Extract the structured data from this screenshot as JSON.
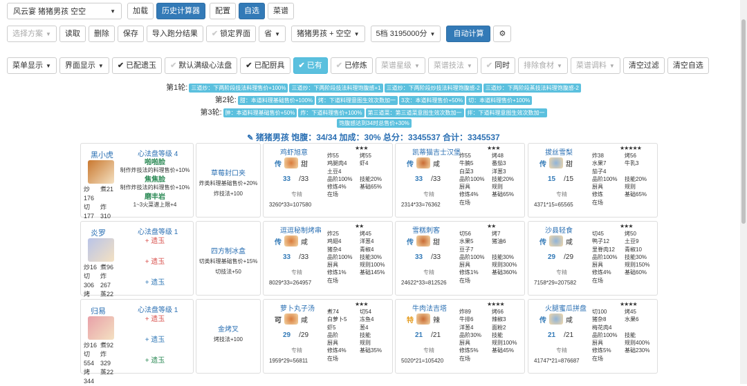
{
  "toolbar1": {
    "rule_select": "风云宴 猪猪男孩 空空",
    "load": "加载",
    "history_calc": "历史计算器",
    "config": "配置",
    "custom": "自选",
    "recipes": "菜谱"
  },
  "toolbar2": {
    "scheme_placeholder": "选择方案",
    "read": "读取",
    "delete": "删除",
    "save": "保存",
    "import": "导入跑分结果",
    "lock": "锁定界面",
    "province": "省",
    "guests": "猪猪男孩 + 空空",
    "grade": "5档 3195000分",
    "auto_calc": "自动计算"
  },
  "toolbar3": {
    "menu_display": "菜单显示",
    "ui_display": "界面显示",
    "with_jade": "已配遗玉",
    "default_full": "默认满级心法盘",
    "with_tools": "已配厨具",
    "owned": "已有",
    "cultivated": "已修炼",
    "recipe_star": "菜谱星级",
    "recipe_skill": "菜谱技法",
    "same_time": "同时",
    "exclude_ing": "排除食材",
    "recipe_season": "菜谱调料",
    "clear_filter": "清空过滤",
    "clear_custom": "清空自选"
  },
  "rounds": [
    {
      "label": "第1轮:",
      "badges": [
        "三道炒：下两阶段技法料理售价+100%",
        "三道炒：下两阶段技法料理饱腹感+1",
        "三道炒：下两阶段炒技法料理饱腹感-2",
        "三道炒：下两阶段蒸技法料理饱腹感-2"
      ]
    },
    {
      "label": "第2轮:",
      "badges": [
        "甜：本道料理基础售价+100%",
        "烤：下道料理意图生效次数加一",
        "3次：本道料理售价+50%",
        "切：本道料理售价+100%"
      ]
    },
    {
      "label": "第3轮:",
      "badges": [
        "肿：本道料理基础售价+50%",
        "炸：下道料理售价+100%",
        "第三道菜：第三道菜意图生效次数加一",
        "拌：下道料理意图生效次数加一"
      ]
    },
    {
      "label": "",
      "badges": [
        "饱腹感达到34时总售价+30%"
      ]
    }
  ],
  "summary": "猪猪男孩 饱腹：34/34 加成：30% 总分：3345537 合计：3345537",
  "chefs": [
    {
      "name": "黑小虎",
      "level": "心法盘等级 4",
      "stats": [
        "炒176",
        "煮21",
        "切177",
        "炸310",
        "烤490",
        "蒸27"
      ],
      "skills": [
        {
          "name": "啪啪脸",
          "desc": "制作炸技法的料理售价+10%"
        },
        {
          "name": "焦焦脸",
          "desc": "制作炸技法的料理售价+10%"
        },
        {
          "name": "磨丰岩",
          "desc": "1~3火菜谱上限+4"
        }
      ],
      "equip_name": "草莓封口夹",
      "equip_desc": [
        "炸类料理基础售价+20%",
        "炸技法+100"
      ],
      "dishes": [
        {
          "name": "鸡虾旭意",
          "stars": "★★★",
          "tag": "传",
          "flavor": "甜",
          "qty": "33",
          "limit": "/33",
          "spec": "专精",
          "formula": "3260*33=107580",
          "stats": [
            "炸55",
            "烤55",
            "鸡腿肉4",
            "虾4",
            "土豆4",
            "",
            "品阶100%",
            "技能20%",
            "修炼4%",
            "基础65%",
            "在场",
            ""
          ]
        },
        {
          "name": "凯蒂猫吉士汉堡",
          "stars": "★★★",
          "tag": "传",
          "flavor": "咸",
          "qty": "33",
          "limit": "/33",
          "spec": "专精",
          "formula": "2314*33=76362",
          "stats": [
            "炸55",
            "烤48",
            "牛腩5",
            "番茄3",
            "白菜3",
            "洋葱3",
            "品阶100%",
            "技能20%",
            "厨具",
            "规则",
            "修炼4%",
            "基础65%",
            "在场",
            ""
          ]
        },
        {
          "name": "拔丝雪梨",
          "stars": "★★★★★",
          "tag": "传",
          "flavor": "甜",
          "qty": "15",
          "limit": "/15",
          "spec": "专精",
          "formula": "4371*15=65565",
          "stats": [
            "炸38",
            "烤56",
            "水果7",
            "牛乳3",
            "茄子4",
            "",
            "品阶100%",
            "技能20%",
            "厨具",
            "规则",
            "修炼",
            "基础65%",
            "在场",
            ""
          ]
        }
      ]
    },
    {
      "name": "炎罗",
      "level": "心法盘等级 1",
      "stats": [
        "炒16",
        "煮96",
        "切306",
        "炸267",
        "烤497",
        "蒸22"
      ],
      "skills": [
        {
          "name": "+ 遗玉",
          "color": "r"
        },
        {
          "name": "+ 遗玉",
          "color": "r"
        },
        {
          "name": "+ 遗玉",
          "color": "b"
        }
      ],
      "equip_name": "四方制冰盒",
      "equip_desc": [
        "切类料理基础售价+15%",
        "切技法+50"
      ],
      "dishes": [
        {
          "name": "逗逗秘制烤串",
          "stars": "★★",
          "tag": "传",
          "flavor": "咸",
          "qty": "33",
          "limit": "/33",
          "spec": "专精",
          "formula": "8029*33=264957",
          "stats": [
            "炸25",
            "烤45",
            "鸡翅4",
            "洋葱4",
            "猪杂4",
            "青椒4",
            "品阶100%",
            "技能30%",
            "厨具",
            "规则100%",
            "修炼1%",
            "基础145%",
            "在场",
            ""
          ]
        },
        {
          "name": "雪糕刺客",
          "stars": "★★",
          "tag": "传",
          "flavor": "甜",
          "qty": "33",
          "limit": "/33",
          "spec": "专精",
          "formula": "24622*33=812526",
          "stats": [
            "切56",
            "烤7",
            "水果5",
            "猪油6",
            "豆子7",
            "",
            "品阶100%",
            "技能30%",
            "厨具",
            "规则300%",
            "修炼1%",
            "基础360%",
            "在场",
            ""
          ]
        },
        {
          "name": "沙县轻食",
          "stars": "★★★",
          "tag": "传",
          "flavor": "咸",
          "qty": "29",
          "limit": "/29",
          "spec": "专精",
          "formula": "7158*29=207582",
          "stats": [
            "切45",
            "烤50",
            "鸭子12",
            "土豆9",
            "里脊肉12",
            "青椒10",
            "品阶100%",
            "技能30%",
            "厨具",
            "规则150%",
            "修炼4%",
            "基础60%",
            "在场",
            ""
          ]
        }
      ]
    },
    {
      "name": "归易",
      "level": "心法盘等级 1",
      "stats": [
        "炒16",
        "煮92",
        "切554",
        "炸329",
        "烤344",
        "蒸22"
      ],
      "skills": [
        {
          "name": "+ 遗玉",
          "color": "r"
        },
        {
          "name": "+ 遗玉",
          "color": "b"
        },
        {
          "name": "+ 遗玉",
          "color": "g"
        }
      ],
      "equip_name": "金烤叉",
      "equip_desc": [
        "烤技法+100"
      ],
      "dishes": [
        {
          "name": "萝卜丸子汤",
          "stars": "★★★",
          "tag": "可",
          "flavor": "咸",
          "qty": "29",
          "limit": "/29",
          "spec": "专精",
          "formula": "1959*29=56811",
          "stats": [
            "煮74",
            "切54",
            "白萝卜5",
            "冻鱼4",
            "虾5",
            "葱4",
            "品阶",
            "技能",
            "厨具",
            "规则",
            "修炼4%",
            "基础35%",
            "在场",
            ""
          ]
        },
        {
          "name": "牛肉法吉塔",
          "stars": "★★★★",
          "tag": "特",
          "flavor": "辣",
          "qty": "21",
          "limit": "/21",
          "spec": "专精",
          "formula": "5020*21=105420",
          "stats": [
            "炸89",
            "烤66",
            "牛排6",
            "辣椒3",
            "洋葱4",
            "面粉2",
            "品阶30%",
            "技能",
            "厨具",
            "规则100%",
            "修炼5%",
            "基础45%",
            "在场",
            ""
          ]
        },
        {
          "name": "火腿蜜瓜拼盘",
          "stars": "★★★★",
          "tag": "传",
          "flavor": "咸",
          "qty": "21",
          "limit": "/21",
          "spec": "专精",
          "formula": "41747*21=876687",
          "stats": [
            "切100",
            "烤45",
            "猪杂8",
            "水果6",
            "梅花肉4",
            "",
            "品阶100%",
            "技能",
            "厨具",
            "规则400%",
            "修炼5%",
            "基础230%",
            "在场",
            ""
          ]
        }
      ]
    }
  ]
}
